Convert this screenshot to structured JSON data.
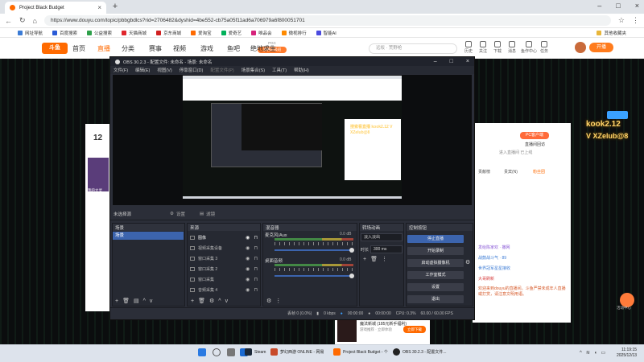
{
  "browser": {
    "tab_title": "Project Black Budget",
    "url": "https://www.douyu.com/topic/pbbgbdlcs?rid=2706482&dyshid=4be552-cb75a05f11ad6a706979a6f800051701",
    "other_favorites": "其他收藏夹",
    "bookmarks": [
      "网址导航",
      "百度搜索",
      "公益搜索",
      "天猫商城",
      "京东商城",
      "爱淘宝",
      "爱奇艺",
      "唯品会",
      "微视排行",
      "智能AI"
    ]
  },
  "site": {
    "logo": "斗鱼",
    "nav": [
      "首页",
      "直播",
      "分类",
      "赛事",
      "视频",
      "游戏",
      "鱼吧",
      "绝地求生"
    ],
    "pgc_label": "PGC",
    "pgc_sub": "沸腾超级班",
    "search_placeholder": "远坂 · 荒野枪",
    "top_icons": [
      "历史",
      "关注",
      "下载",
      "消息",
      "鱼作中心",
      "任务"
    ],
    "open_broadcast": "开播"
  },
  "left_card": {
    "count": "12",
    "caption": "我的大灵"
  },
  "right_panel": {
    "pc_badge": "PC客户端",
    "line1": "直播间回访",
    "line2": "进入直播间 已上线",
    "tabs": [
      "贡献榜",
      "贵宾(N)",
      "粉丝团"
    ],
    "lines": [
      "发给陈家欢 · 撒网",
      "战鼓战斗气 · 89",
      "世界冠军星星接收",
      "大哥刷新"
    ],
    "notice": "欢迎来到douyu的直播间。斗鱼严禁未成年人直播或打赏，请注意文明用语。",
    "promo": "kook2.12",
    "promo_sub": "V XZelub@8"
  },
  "activity_label": "活动中心",
  "ad": {
    "title": "魔法新城 (185元新手福利)",
    "subtitle": "游戏推荐 · 立即体验",
    "button": "立即下载"
  },
  "obs": {
    "title": "OBS 30.2.3 - 配置文件: 未命名 - 场景: 未命名",
    "menu": [
      "文件(F)",
      "编辑(E)",
      "视图(V)",
      "停靠窗口(D)",
      "配置文件(P)",
      "场景集合(S)",
      "工具(T)",
      "帮助(H)"
    ],
    "source_bar": {
      "selected": "未选择源",
      "settings": "设置",
      "filters": "滤镜"
    },
    "docks": {
      "scenes": "场景",
      "sources": "来源",
      "mixer": "混音器",
      "transitions": "转场动画",
      "controls": "控制按钮"
    },
    "scene_items": [
      "场景"
    ],
    "sources": [
      "图像",
      "视频采集设备",
      "窗口采集 3",
      "窗口采集 2",
      "窗口采集",
      "音频采集 4"
    ],
    "mixer": [
      {
        "name": "麦克风/Aux",
        "db": "0.0 dB"
      },
      {
        "name": "桌面音频",
        "db": "0.0 dB"
      }
    ],
    "transition": {
      "type": "淡入淡出",
      "duration_label": "时长",
      "duration": "300 ms"
    },
    "controls": [
      "停止直播",
      "开始录制",
      "启动虚拟摄像机",
      "工作室模式",
      "设置",
      "退出"
    ],
    "status": {
      "dropped": "丢帧 0 (0.0%)",
      "bitrate": "0 kbps",
      "stream_time": "00:00:00",
      "rec_time": "00:00:00",
      "cpu": "CPU: 0.3%",
      "fps": "60.00 / 60.00 FPS"
    },
    "preview_stream_text": "搜索看直播 kook2.12 V XZelub@8"
  },
  "taskbar": {
    "apps": [
      "Steam",
      "梦幻西游 ONLINE - 网易",
      "Project Black Budget - 个",
      "OBS 30.2.3 - 配置文件..."
    ],
    "time": "11:19:15",
    "date": "2025/12/13"
  },
  "colors": {
    "accent": "#ff6a00",
    "obs_blue": "#3c64ad",
    "obs_bg": "#2b2e38"
  }
}
